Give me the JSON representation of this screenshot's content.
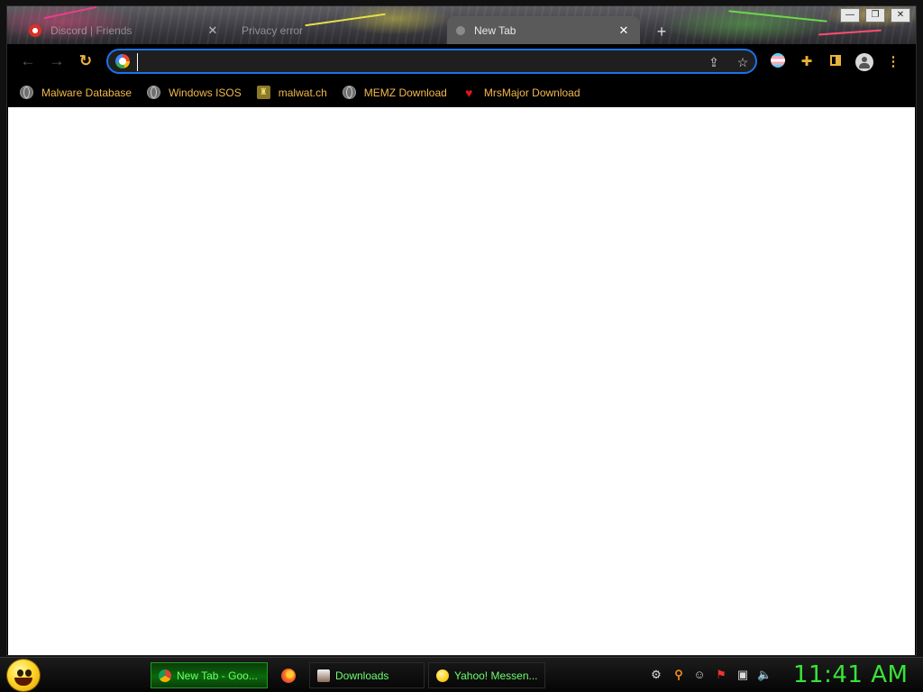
{
  "browser": {
    "tabs": [
      {
        "title": "Discord | Friends",
        "state": "inactive"
      },
      {
        "title": "Privacy error",
        "state": "inactive"
      },
      {
        "title": "New Tab",
        "state": "active"
      }
    ],
    "new_tab_glyph": "+",
    "window_controls": {
      "minimize": "—",
      "maximize": "❐",
      "close": "✕"
    },
    "toolbar": {
      "back_icon": "arrow-left-icon",
      "forward_icon": "arrow-right-icon",
      "reload_icon": "reload-icon"
    },
    "omnibox": {
      "value": "",
      "placeholder": ""
    },
    "bookmarks": [
      {
        "label": "Malware Database",
        "icon": "globe-icon"
      },
      {
        "label": "Windows ISOS",
        "icon": "globe-icon"
      },
      {
        "label": "malwat.ch",
        "icon": "malwatch-icon"
      },
      {
        "label": "MEMZ Download",
        "icon": "globe-icon"
      },
      {
        "label": "MrsMajor Download",
        "icon": "heart-icon"
      }
    ]
  },
  "taskbar": {
    "tasks": [
      {
        "label": "New Tab - Goo...",
        "icon": "chrome-icon",
        "active": true
      },
      {
        "label": "",
        "icon": "firefox-icon",
        "active": false
      },
      {
        "label": "Downloads",
        "icon": "downloads-icon",
        "active": false
      },
      {
        "label": "Yahoo! Messen...",
        "icon": "yahoo-messenger-icon",
        "active": false
      }
    ],
    "tray_icons": [
      "network-icon",
      "search-icon",
      "messenger-icon",
      "flag-icon",
      "display-icon",
      "volume-icon"
    ],
    "clock": "11:41 AM"
  },
  "colors": {
    "bookmark_text": "#f2b84b",
    "omnibox_focus": "#1a73e8",
    "taskbar_text": "#6cff6c",
    "clock": "#38e338"
  }
}
